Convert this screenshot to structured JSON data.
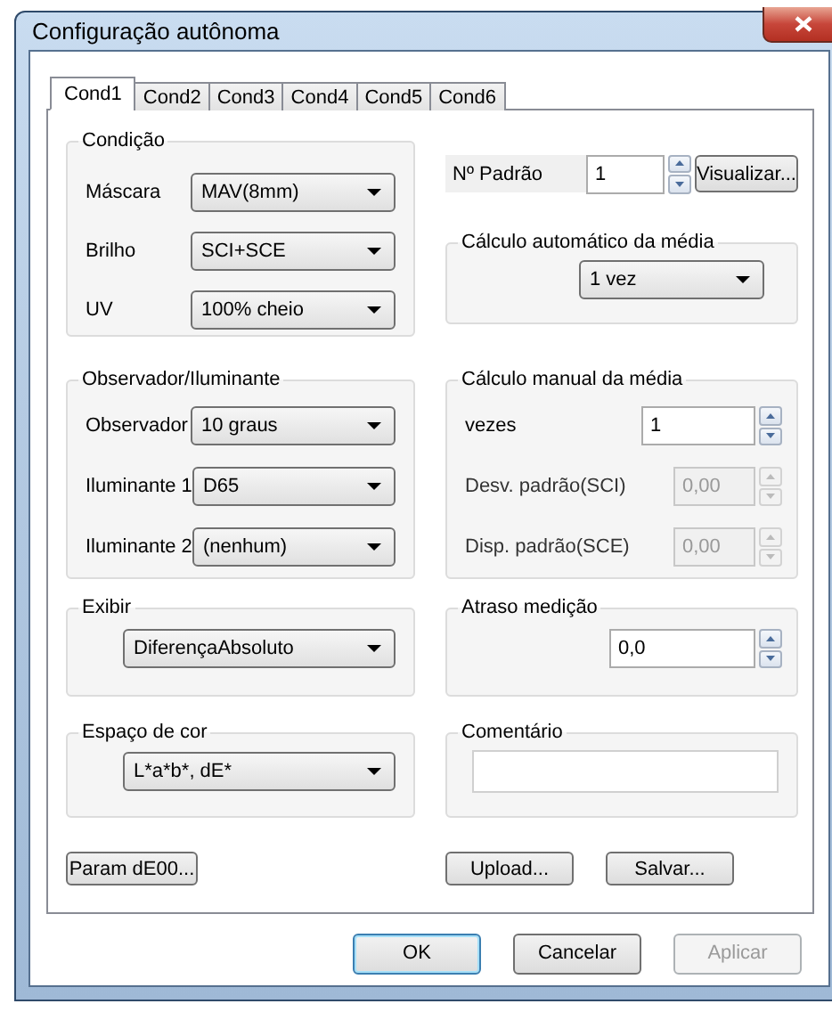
{
  "window": {
    "title": "Configuração autônoma"
  },
  "tabs": [
    {
      "label": "Cond1",
      "selected": true
    },
    {
      "label": "Cond2",
      "selected": false
    },
    {
      "label": "Cond3",
      "selected": false
    },
    {
      "label": "Cond4",
      "selected": false
    },
    {
      "label": "Cond5",
      "selected": false
    },
    {
      "label": "Cond6",
      "selected": false
    }
  ],
  "condicao": {
    "title": "Condição",
    "rows": [
      {
        "label": "Máscara",
        "value": "MAV(8mm)"
      },
      {
        "label": "Brilho",
        "value": "SCI+SCE"
      },
      {
        "label": "UV",
        "value": "100% cheio"
      }
    ]
  },
  "padrao": {
    "label": "Nº Padrão",
    "value": "1",
    "button": "Visualizar..."
  },
  "calculo_automatico": {
    "title": "Cálculo automático da média",
    "value": "1 vez"
  },
  "observador": {
    "title": "Observador/Iluminante",
    "rows": [
      {
        "label": "Observador",
        "value": "10 graus"
      },
      {
        "label": "Iluminante 1",
        "value": "D65"
      },
      {
        "label": "Iluminante 2",
        "value": "(nenhum)"
      }
    ]
  },
  "calculo_manual": {
    "title": "Cálculo manual da média",
    "rows": [
      {
        "label": "vezes",
        "value": "1",
        "disabled": false
      },
      {
        "label": "Desv. padrão(SCI)",
        "value": "0,00",
        "disabled": true
      },
      {
        "label": "Disp. padrão(SCE)",
        "value": "0,00",
        "disabled": true
      }
    ]
  },
  "exibir": {
    "title": "Exibir",
    "value": "DiferençaAbsoluto"
  },
  "atraso": {
    "title": "Atraso medição",
    "value": "0,0"
  },
  "espaco": {
    "title": "Espaço de cor",
    "value": "L*a*b*, dE*"
  },
  "comentario": {
    "title": "Comentário"
  },
  "panel_buttons": [
    {
      "label": "Param dE00..."
    },
    {
      "label": "Upload..."
    },
    {
      "label": "Salvar..."
    }
  ],
  "dialog_buttons": [
    {
      "label": "OK",
      "default": true,
      "disabled": false
    },
    {
      "label": "Cancelar",
      "default": false,
      "disabled": false
    },
    {
      "label": "Aplicar",
      "default": false,
      "disabled": true
    }
  ]
}
